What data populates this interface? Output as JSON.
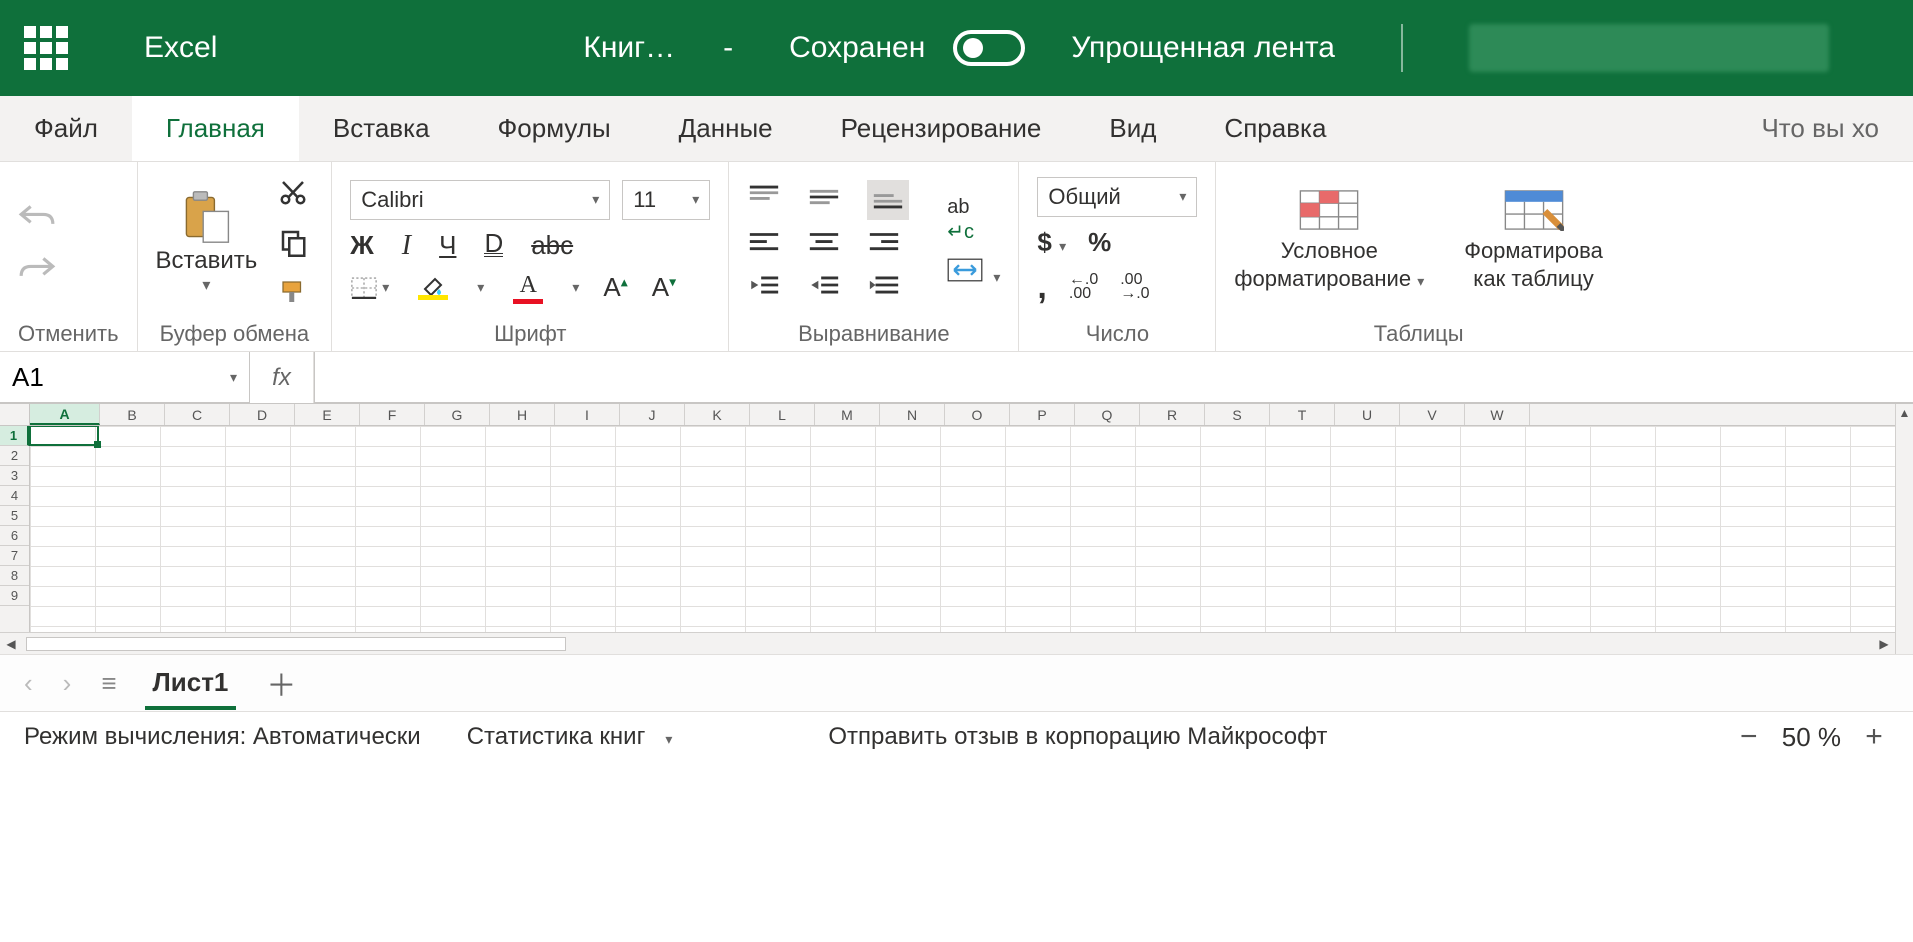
{
  "header": {
    "app_name": "Excel",
    "doc_title": "Книг…",
    "dash": "-",
    "saved_label": "Сохранен",
    "ribbon_toggle_label": "Упрощенная лента"
  },
  "tabs": {
    "file": "Файл",
    "home": "Главная",
    "insert": "Вставка",
    "formulas": "Формулы",
    "data": "Данные",
    "review": "Рецензирование",
    "view": "Вид",
    "help": "Справка",
    "tell_me": "Что вы хо"
  },
  "ribbon": {
    "undo_group": "Отменить",
    "clipboard": {
      "paste": "Вставить",
      "group": "Буфер обмена"
    },
    "font": {
      "name": "Calibri",
      "size": "11",
      "bold": "Ж",
      "italic": "I",
      "underline": "Ч",
      "double_underline": "D",
      "strike": "abc",
      "grow": "A",
      "shrink": "A",
      "group": "Шрифт"
    },
    "alignment": {
      "group": "Выравнивание",
      "wrap": "ab↵"
    },
    "number": {
      "format": "Общий",
      "currency": "$",
      "percent": "%",
      "comma": ",",
      "inc_dec": "←.0\n.00",
      "dec_dec": ".00\n→.0",
      "group": "Число"
    },
    "tables": {
      "conditional": "Условное\nформатирование",
      "format_table": "Форматирова\nкак таблицу",
      "group": "Таблицы"
    }
  },
  "formula_bar": {
    "name_box": "A1",
    "fx": "fx",
    "value": ""
  },
  "grid": {
    "columns": [
      "A",
      "B",
      "C",
      "D",
      "E",
      "F",
      "G",
      "H",
      "I",
      "J",
      "K",
      "L",
      "M",
      "N",
      "O",
      "P",
      "Q",
      "R",
      "S",
      "T",
      "U",
      "V",
      "W"
    ],
    "rows": [
      "1",
      "2",
      "3",
      "4",
      "5",
      "6",
      "7",
      "8",
      "9"
    ],
    "active_col": "A",
    "active_row": "1"
  },
  "sheets": {
    "active": "Лист1"
  },
  "status": {
    "calc_mode": "Режим вычисления: Автоматически",
    "stats": "Статистика книг",
    "feedback": "Отправить отзыв в корпорацию Майкрософт",
    "zoom": "50 %"
  }
}
